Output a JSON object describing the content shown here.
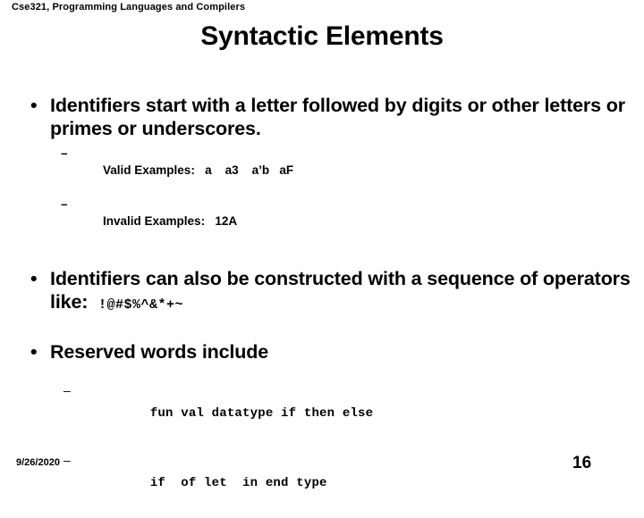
{
  "slide": {
    "header": "Cse321, Programming Languages and Compilers",
    "title": "Syntactic Elements",
    "bullets": [
      {
        "bullet_glyph": "•",
        "text": "Identifiers start with a letter followed by digits or other letters or primes or underscores.",
        "sub": [
          {
            "dash_glyph": "–",
            "label": "Valid Examples:",
            "examples": "a    a3    a’b   aF"
          },
          {
            "dash_glyph": "–",
            "label": "Invalid Examples:",
            "examples": "12A"
          }
        ]
      },
      {
        "bullet_glyph": "•",
        "text": "Identifiers can also be constructed with a sequence of operators like:",
        "operators": "!@#$%^&*+~"
      },
      {
        "bullet_glyph": "•",
        "text": "Reserved words include",
        "reserved": [
          {
            "dash_glyph": "–",
            "words": "fun val datatype if then else"
          },
          {
            "dash_glyph": "–",
            "words": "if  of let  in end type"
          }
        ]
      }
    ],
    "footer": {
      "date": "9/26/2020",
      "page_number": "16"
    },
    "colors": {
      "background": "#ffffff",
      "text": "#000000"
    }
  }
}
